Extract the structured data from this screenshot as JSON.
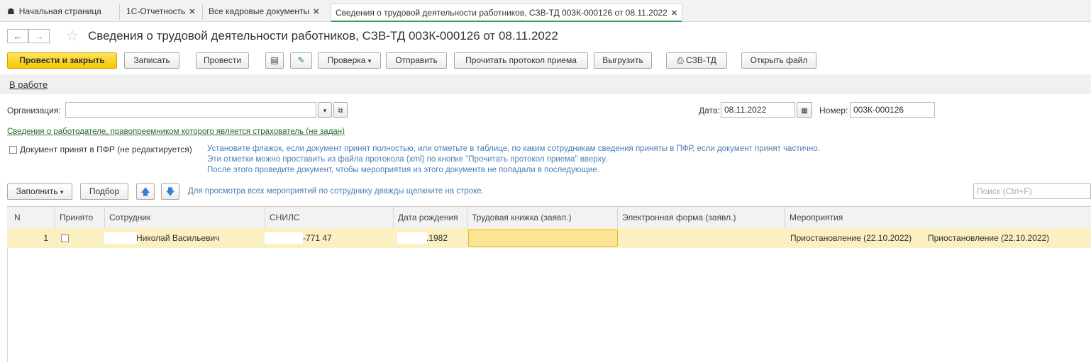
{
  "tabs": {
    "home": "Начальная страница",
    "t1": "1С-Отчетность",
    "t2": "Все кадровые документы",
    "t3": "Сведения о трудовой деятельности работников, СЗВ-ТД 003К-000126 от 08.11.2022"
  },
  "header": {
    "title": "Сведения о трудовой деятельности работников, СЗВ-ТД 003К-000126 от 08.11.2022"
  },
  "toolbar": {
    "post_close": "Провести и закрыть",
    "save": "Записать",
    "post": "Провести",
    "check": "Проверка",
    "send": "Отправить",
    "read_protocol": "Прочитать протокол приема",
    "export": "Выгрузить",
    "print": "СЗВ-ТД",
    "open_file": "Открыть файл"
  },
  "status_link": "В работе",
  "form": {
    "org_label": "Организация:",
    "org_value": "",
    "date_label": "Дата:",
    "date_value": "08.11.2022",
    "number_label": "Номер:",
    "number_value": "003К-000126",
    "employer_link": "Сведения о работодателе, правопреемником которого является страхователь (не задан)",
    "accepted_label": "Документ принят в ПФР (не редактируется)",
    "hint1": "Установите флажок, если документ принят полностью, или отметьте в таблице, по каким сотрудникам сведения приняты в ПФР, если документ принят частично.",
    "hint2": "Эти отметки можно проставить из файла протокола (xml) по кнопке \"Прочитать протокол приема\" вверху.",
    "hint3": "После этого проведите документ, чтобы мероприятия из этого документа не попадали в последующие."
  },
  "table_toolbar": {
    "fill": "Заполнить",
    "select": "Подбор",
    "hint": "Для просмотра всех мероприятий по сотруднику дважды щелкните на строке.",
    "search_placeholder": "Поиск (Ctrl+F)"
  },
  "table": {
    "headers": [
      "N",
      "Принято",
      "Сотрудник",
      "СНИЛС",
      "Дата рождения",
      "Трудовая книжка (заявл.)",
      "Электронная форма (заявл.)",
      "Мероприятия"
    ],
    "rows": [
      {
        "n": "1",
        "employee": "Николай Васильевич",
        "snils": "-771 47",
        "birth": ".1982",
        "book": "",
        "eform": "",
        "event1": "Приостановление (22.10.2022)",
        "event2": "Приостановление (22.10.2022)"
      }
    ]
  },
  "colors": {
    "primary_button": "#f6c800",
    "row_highlight": "#fbf0c2",
    "hint_text": "#4a7fb5",
    "link_green": "#2a6b2a"
  }
}
